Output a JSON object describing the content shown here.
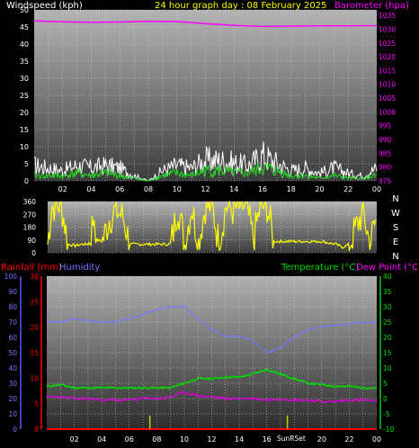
{
  "header": {
    "windspeed_label": "Windspeed (kph)",
    "title": "24 hour graph day : 08 February 2025",
    "barometer_label": "Barometer (hpa)"
  },
  "lower_header": {
    "rainfall_label": "Rainfall (mm)",
    "humidity_label": "Humidity",
    "temperature_label": "Temperature (°C)",
    "dewpoint_label": "Dew Point (°C)"
  },
  "compass": [
    "N",
    "W",
    "S",
    "E",
    "N"
  ],
  "sun_label": "SunRSet",
  "colors": {
    "windspeed_text": "#ffffff",
    "title_text": "#ffff00",
    "barometer": "#ff00ff",
    "wind_gust": "#ffffff",
    "wind_avg": "#22dd22",
    "direction": "#ffff00",
    "rainfall": "#ff0000",
    "humidity": "#7777ff",
    "temperature": "#00dd00",
    "dewpoint": "#dd00dd"
  },
  "chart_data": [
    {
      "type": "line",
      "name": "wind_barometer",
      "x_ticks": [
        "02",
        "04",
        "06",
        "08",
        "10",
        "12",
        "14",
        "16",
        "18",
        "20",
        "22",
        "00"
      ],
      "y_left_ticks": [
        0,
        5,
        10,
        15,
        20,
        25,
        30,
        35,
        40,
        45,
        50
      ],
      "y_left_lim": [
        0,
        50
      ],
      "y_right_ticks": [
        975,
        980,
        985,
        990,
        995,
        1000,
        1005,
        1010,
        1015,
        1020,
        1025,
        1030,
        1035
      ],
      "y_right_lim": [
        975,
        1037
      ],
      "barometer": {
        "x": [
          0,
          2,
          4,
          6,
          8,
          10,
          12,
          14,
          16,
          18,
          20,
          22,
          24
        ],
        "y": [
          1033,
          1032.7,
          1032.5,
          1032.6,
          1032.9,
          1032.8,
          1032,
          1031.4,
          1031,
          1031.1,
          1031.2,
          1031.2,
          1031.3
        ]
      },
      "wind_gust_envelope": {
        "x": [
          0,
          1,
          2,
          3,
          4,
          5,
          6,
          7,
          8,
          9,
          10,
          11,
          12,
          13,
          14,
          15,
          16,
          17,
          18,
          19,
          20,
          21,
          22,
          23,
          24
        ],
        "y": [
          6,
          5,
          4,
          6,
          5,
          6,
          5,
          2,
          0,
          4,
          6,
          5,
          8,
          8,
          7,
          6,
          10,
          7,
          4,
          5,
          3,
          5,
          3,
          2,
          5
        ]
      },
      "wind_avg_envelope": {
        "x": [
          0,
          1,
          2,
          3,
          4,
          5,
          6,
          7,
          8,
          9,
          10,
          11,
          12,
          13,
          14,
          15,
          16,
          17,
          18,
          19,
          20,
          21,
          22,
          23,
          24
        ],
        "y": [
          2,
          2,
          2,
          3,
          2,
          3,
          2,
          1,
          0,
          2,
          3,
          2,
          4,
          4,
          3,
          3,
          5,
          4,
          2,
          2,
          1,
          2,
          1,
          1,
          2
        ]
      }
    },
    {
      "type": "line",
      "name": "wind_direction",
      "y_ticks": [
        360,
        270,
        180,
        90,
        0
      ],
      "y_lim": [
        0,
        360
      ],
      "x": [
        0,
        0.3,
        1,
        1.5,
        2,
        2.5,
        3,
        3.4,
        3.6,
        4,
        4.5,
        5,
        5.5,
        6,
        6.5,
        7,
        8,
        9,
        9.5,
        10,
        10.5,
        11,
        11.5,
        12,
        12.5,
        13,
        13.5,
        14,
        14.5,
        15,
        15.5,
        16,
        16.5,
        17,
        18,
        19,
        20,
        21,
        21.5,
        22,
        23,
        23.5,
        24
      ],
      "y": [
        60,
        330,
        340,
        60,
        50,
        60,
        60,
        270,
        90,
        80,
        240,
        300,
        250,
        60,
        60,
        60,
        60,
        60,
        330,
        60,
        330,
        70,
        330,
        330,
        60,
        330,
        300,
        320,
        330,
        90,
        320,
        330,
        80,
        80,
        80,
        80,
        80,
        60,
        40,
        60,
        290,
        60,
        260
      ]
    },
    {
      "type": "line",
      "name": "temp_humidity_rain",
      "x_ticks": [
        "02",
        "04",
        "06",
        "08",
        "10",
        "12",
        "14",
        "16",
        "18",
        "20",
        "22",
        "00"
      ],
      "y_humidity_ticks": [
        0,
        10,
        20,
        30,
        40,
        50,
        60,
        70,
        80,
        90,
        100
      ],
      "y_humidity_lim": [
        0,
        100
      ],
      "y_rain_ticks": [
        0,
        5,
        10,
        15,
        20,
        25,
        30
      ],
      "y_rain_lim": [
        0,
        30
      ],
      "y_temp_ticks": [
        -10,
        -5,
        0,
        5,
        10,
        15,
        20,
        25,
        30,
        35,
        40
      ],
      "y_temp_lim": [
        -10,
        40
      ],
      "rainfall": {
        "x": [
          0,
          24
        ],
        "y": [
          0,
          0
        ]
      },
      "humidity": {
        "x": [
          0,
          1,
          2,
          3,
          4,
          5,
          6,
          7,
          8,
          9,
          10,
          11,
          12,
          13,
          14,
          15,
          16,
          17,
          18,
          19,
          20,
          21,
          22,
          23,
          24
        ],
        "y": [
          70,
          70,
          72,
          71,
          70,
          70,
          72,
          75,
          78,
          80,
          80,
          72,
          65,
          61,
          61,
          58,
          50,
          53,
          60,
          65,
          67,
          68,
          69,
          70,
          70
        ]
      },
      "temperature": {
        "x": [
          0,
          1,
          2,
          3,
          4,
          5,
          6,
          7,
          8,
          9,
          10,
          11,
          12,
          13,
          14,
          15,
          16,
          17,
          18,
          19,
          20,
          21,
          22,
          23,
          24
        ],
        "y": [
          4,
          4.5,
          3.5,
          3.5,
          3.5,
          3.5,
          3.5,
          3.5,
          3.5,
          3.5,
          5,
          6.5,
          6.5,
          7,
          7,
          8,
          9.5,
          8,
          6.5,
          5,
          4.5,
          4,
          4,
          3.5,
          3.5
        ]
      },
      "dewpoint": {
        "x": [
          0,
          1,
          2,
          3,
          4,
          5,
          6,
          7,
          8,
          9,
          10,
          11,
          12,
          13,
          14,
          15,
          16,
          17,
          18,
          19,
          20,
          21,
          22,
          23,
          24
        ],
        "y": [
          0.5,
          0.5,
          0,
          0,
          -0.5,
          -0.5,
          -0.5,
          0,
          0,
          0.5,
          2,
          1,
          0.5,
          0,
          0,
          0,
          -0.5,
          0,
          -0.5,
          -0.5,
          -1,
          -1,
          -0.5,
          -0.5,
          -1
        ]
      },
      "sun_markers_x": [
        7.5,
        17.5
      ]
    }
  ]
}
